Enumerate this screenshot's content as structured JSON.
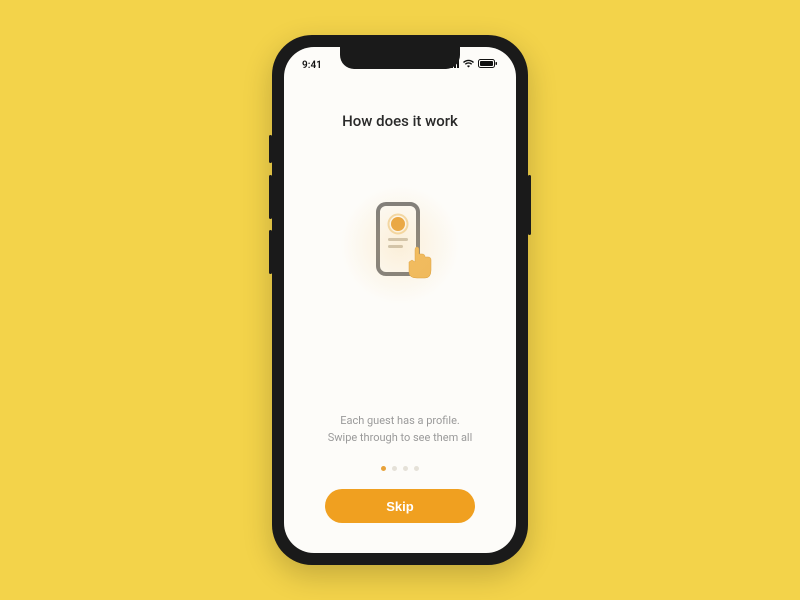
{
  "status": {
    "time": "9:41"
  },
  "onboarding": {
    "title": "How does it work",
    "description_line1": "Each guest has a profile.",
    "description_line2": "Swipe through to see them all",
    "skip_label": "Skip",
    "page_index": 0,
    "page_count": 4
  },
  "colors": {
    "background": "#f3d34a",
    "accent": "#f0a020"
  }
}
